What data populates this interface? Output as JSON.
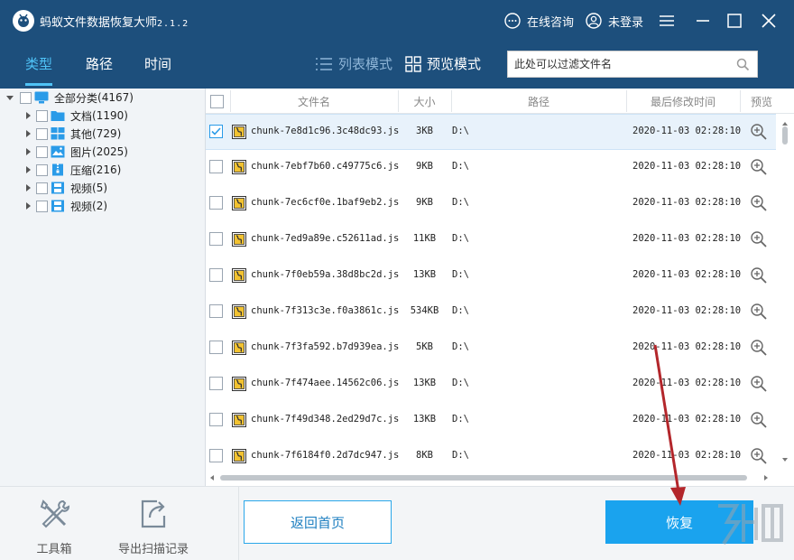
{
  "titlebar": {
    "app_name": "蚂蚁文件数据恢复大师",
    "version": "2.1.2",
    "consult_label": "在线咨询",
    "login_label": "未登录"
  },
  "toolbar": {
    "tabs": [
      {
        "label": "类型",
        "active": true
      },
      {
        "label": "路径",
        "active": false
      },
      {
        "label": "时间",
        "active": false
      }
    ],
    "list_mode_label": "列表模式",
    "preview_mode_label": "预览模式",
    "search_placeholder": "此处可以过滤文件名"
  },
  "tree": {
    "root": {
      "label": "全部分类",
      "count": "(4167)"
    },
    "items": [
      {
        "label": "文档",
        "count": "(1190)",
        "icon": "folder-icon"
      },
      {
        "label": "其他",
        "count": "(729)",
        "icon": "grid-icon"
      },
      {
        "label": "图片",
        "count": "(2025)",
        "icon": "image-icon"
      },
      {
        "label": "压缩",
        "count": "(216)",
        "icon": "archive-icon"
      },
      {
        "label": "视频",
        "count": "(5)",
        "icon": "video-icon"
      },
      {
        "label": "视频",
        "count": "(2)",
        "icon": "video-icon"
      }
    ]
  },
  "table": {
    "headers": {
      "name": "文件名",
      "size": "大小",
      "path": "路径",
      "modified": "最后修改时间",
      "preview": "预览"
    },
    "rows": [
      {
        "name": "chunk-7e8d1c96.3c48dc93.js",
        "size": "3KB",
        "path": "D:\\",
        "modified": "2020-11-03 02:28:10",
        "checked": true
      },
      {
        "name": "chunk-7ebf7b60.c49775c6.js",
        "size": "9KB",
        "path": "D:\\",
        "modified": "2020-11-03 02:28:10",
        "checked": false
      },
      {
        "name": "chunk-7ec6cf0e.1baf9eb2.js",
        "size": "9KB",
        "path": "D:\\",
        "modified": "2020-11-03 02:28:10",
        "checked": false
      },
      {
        "name": "chunk-7ed9a89e.c52611ad.js",
        "size": "11KB",
        "path": "D:\\",
        "modified": "2020-11-03 02:28:10",
        "checked": false
      },
      {
        "name": "chunk-7f0eb59a.38d8bc2d.js",
        "size": "13KB",
        "path": "D:\\",
        "modified": "2020-11-03 02:28:10",
        "checked": false
      },
      {
        "name": "chunk-7f313c3e.f0a3861c.js",
        "size": "534KB",
        "path": "D:\\",
        "modified": "2020-11-03 02:28:10",
        "checked": false
      },
      {
        "name": "chunk-7f3fa592.b7d939ea.js",
        "size": "5KB",
        "path": "D:\\",
        "modified": "2020-11-03 02:28:10",
        "checked": false
      },
      {
        "name": "chunk-7f474aee.14562c06.js",
        "size": "13KB",
        "path": "D:\\",
        "modified": "2020-11-03 02:28:10",
        "checked": false
      },
      {
        "name": "chunk-7f49d348.2ed29d7c.js",
        "size": "13KB",
        "path": "D:\\",
        "modified": "2020-11-03 02:28:10",
        "checked": false
      },
      {
        "name": "chunk-7f6184f0.2d7dc947.js",
        "size": "8KB",
        "path": "D:\\",
        "modified": "2020-11-03 02:28:10",
        "checked": false
      }
    ]
  },
  "bottom": {
    "toolbox_label": "工具箱",
    "export_label": "导出扫描记录",
    "home_button": "返回首页",
    "recover_button": "恢复"
  },
  "colors": {
    "titlebar_bg": "#1d4f7c",
    "accent": "#4fc3f7",
    "button_blue": "#1aa3ee",
    "annotation_arrow": "#b3262b"
  }
}
